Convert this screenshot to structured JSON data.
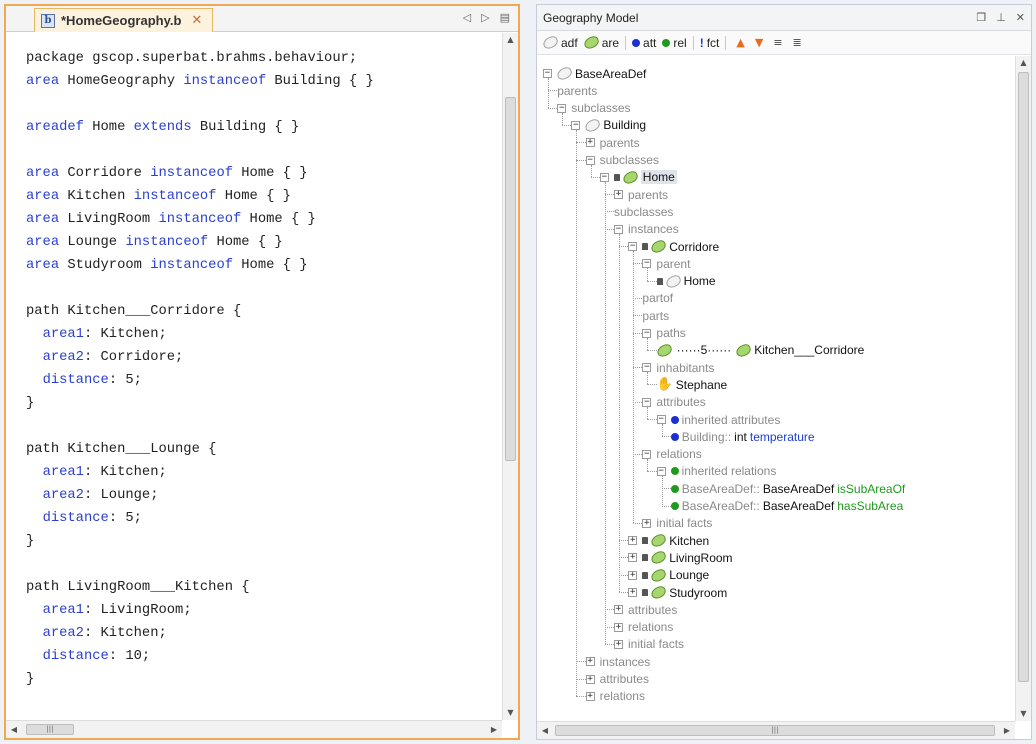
{
  "editor": {
    "tab_label": "*HomeGeography.b",
    "file_icon": "b",
    "code_lines": [
      [
        [
          "t",
          "package gscop.superbat.brahms.behaviour;"
        ]
      ],
      [
        [
          "k",
          "area"
        ],
        [
          "t",
          " HomeGeography "
        ],
        [
          "k",
          "instanceof"
        ],
        [
          "t",
          " Building { }"
        ]
      ],
      [],
      [
        [
          "k",
          "areadef"
        ],
        [
          "t",
          " Home "
        ],
        [
          "k",
          "extends"
        ],
        [
          "t",
          " Building { }"
        ]
      ],
      [],
      [
        [
          "k",
          "area"
        ],
        [
          "t",
          " Corridore "
        ],
        [
          "k",
          "instanceof"
        ],
        [
          "t",
          " Home { }"
        ]
      ],
      [
        [
          "k",
          "area"
        ],
        [
          "t",
          " Kitchen "
        ],
        [
          "k",
          "instanceof"
        ],
        [
          "t",
          " Home { }"
        ]
      ],
      [
        [
          "k",
          "area"
        ],
        [
          "t",
          " LivingRoom "
        ],
        [
          "k",
          "instanceof"
        ],
        [
          "t",
          " Home { }"
        ]
      ],
      [
        [
          "k",
          "area"
        ],
        [
          "t",
          " Lounge "
        ],
        [
          "k",
          "instanceof"
        ],
        [
          "t",
          " Home { }"
        ]
      ],
      [
        [
          "k",
          "area"
        ],
        [
          "t",
          " Studyroom "
        ],
        [
          "k",
          "instanceof"
        ],
        [
          "t",
          " Home { }"
        ]
      ],
      [],
      [
        [
          "t",
          "path Kitchen___Corridore {"
        ]
      ],
      [
        [
          "t",
          "  "
        ],
        [
          "k",
          "area1"
        ],
        [
          "t",
          ": Kitchen;"
        ]
      ],
      [
        [
          "t",
          "  "
        ],
        [
          "k",
          "area2"
        ],
        [
          "t",
          ": Corridore;"
        ]
      ],
      [
        [
          "t",
          "  "
        ],
        [
          "k",
          "distance"
        ],
        [
          "t",
          ": 5;"
        ]
      ],
      [
        [
          "t",
          "}"
        ]
      ],
      [],
      [
        [
          "t",
          "path Kitchen___Lounge {"
        ]
      ],
      [
        [
          "t",
          "  "
        ],
        [
          "k",
          "area1"
        ],
        [
          "t",
          ": Kitchen;"
        ]
      ],
      [
        [
          "t",
          "  "
        ],
        [
          "k",
          "area2"
        ],
        [
          "t",
          ": Lounge;"
        ]
      ],
      [
        [
          "t",
          "  "
        ],
        [
          "k",
          "distance"
        ],
        [
          "t",
          ": 5;"
        ]
      ],
      [
        [
          "t",
          "}"
        ]
      ],
      [],
      [
        [
          "t",
          "path LivingRoom___Kitchen {"
        ]
      ],
      [
        [
          "t",
          "  "
        ],
        [
          "k",
          "area1"
        ],
        [
          "t",
          ": LivingRoom;"
        ]
      ],
      [
        [
          "t",
          "  "
        ],
        [
          "k",
          "area2"
        ],
        [
          "t",
          ": Kitchen;"
        ]
      ],
      [
        [
          "t",
          "  "
        ],
        [
          "k",
          "distance"
        ],
        [
          "t",
          ": 10;"
        ]
      ],
      [
        [
          "t",
          "}"
        ]
      ]
    ]
  },
  "panel": {
    "title": "Geography Model",
    "toolbar": [
      {
        "icon": "grey-blob",
        "label": "adf"
      },
      {
        "icon": "green-blob",
        "label": "are"
      },
      {
        "icon": "blue-dot",
        "label": "att"
      },
      {
        "icon": "green-dot",
        "label": "rel"
      },
      {
        "icon": "exclamation",
        "label": "fct"
      }
    ],
    "tree": [
      {
        "d": 0,
        "exp": "-",
        "icon": "grey-blob",
        "label": "BaseAreaDef",
        "style": "dark"
      },
      {
        "d": 1,
        "label": "parents",
        "style": "grey"
      },
      {
        "d": 1,
        "exp": "-",
        "label": "subclasses",
        "style": "grey"
      },
      {
        "d": 2,
        "exp": "-",
        "icon": "grey-blob",
        "label": "Building",
        "style": "dark"
      },
      {
        "d": 3,
        "exp": "+",
        "label": "parents",
        "style": "grey"
      },
      {
        "d": 3,
        "exp": "-",
        "label": "subclasses",
        "style": "grey"
      },
      {
        "d": 4,
        "exp": "-",
        "lock": true,
        "icon": "green-blob",
        "label": "Home",
        "style": "dark",
        "selected": true
      },
      {
        "d": 5,
        "exp": "+",
        "label": "parents",
        "style": "grey"
      },
      {
        "d": 5,
        "label": "subclasses",
        "style": "grey"
      },
      {
        "d": 5,
        "exp": "-",
        "label": "instances",
        "style": "grey"
      },
      {
        "d": 6,
        "exp": "-",
        "lock": true,
        "icon": "green-blob",
        "label": "Corridore",
        "style": "dark"
      },
      {
        "d": 7,
        "exp": "-",
        "label": "parent",
        "style": "grey"
      },
      {
        "d": 8,
        "lock": true,
        "icon": "grey-blob",
        "label": "Home",
        "style": "dark"
      },
      {
        "d": 7,
        "label": "partof",
        "style": "grey"
      },
      {
        "d": 7,
        "label": "parts",
        "style": "grey"
      },
      {
        "d": 7,
        "exp": "-",
        "label": "paths",
        "style": "grey"
      },
      {
        "d": 8,
        "icon": "green-blob",
        "path": "5",
        "icon2": "green-blob",
        "label": "Kitchen___Corridore",
        "style": "dark"
      },
      {
        "d": 7,
        "exp": "-",
        "label": "inhabitants",
        "style": "grey"
      },
      {
        "d": 8,
        "icon": "hand",
        "label": "Stephane",
        "style": "dark"
      },
      {
        "d": 7,
        "exp": "-",
        "label": "attributes",
        "style": "grey"
      },
      {
        "d": 8,
        "exp": "-",
        "icon": "blue-dot",
        "label": "inherited attributes",
        "style": "grey"
      },
      {
        "d": 9,
        "icon": "blue-dot",
        "pre": "Building::",
        "label": "int",
        "post": "temperature",
        "post_style": "blue",
        "style": "dark"
      },
      {
        "d": 7,
        "exp": "-",
        "label": "relations",
        "style": "grey"
      },
      {
        "d": 8,
        "exp": "-",
        "icon": "green-dot",
        "label": "inherited relations",
        "style": "grey"
      },
      {
        "d": 9,
        "icon": "green-dot",
        "pre": "BaseAreaDef::",
        "label": "BaseAreaDef",
        "post": "isSubAreaOf",
        "post_style": "green",
        "style": "dark"
      },
      {
        "d": 9,
        "icon": "green-dot",
        "pre": "BaseAreaDef::",
        "label": "BaseAreaDef",
        "post": "hasSubArea",
        "post_style": "green",
        "style": "dark"
      },
      {
        "d": 7,
        "exp": "+",
        "label": "initial facts",
        "style": "grey"
      },
      {
        "d": 6,
        "exp": "+",
        "lock": true,
        "icon": "green-blob",
        "label": "Kitchen",
        "style": "dark"
      },
      {
        "d": 6,
        "exp": "+",
        "lock": true,
        "icon": "green-blob",
        "label": "LivingRoom",
        "style": "dark"
      },
      {
        "d": 6,
        "exp": "+",
        "lock": true,
        "icon": "green-blob",
        "label": "Lounge",
        "style": "dark"
      },
      {
        "d": 6,
        "exp": "+",
        "lock": true,
        "icon": "green-blob",
        "label": "Studyroom",
        "style": "dark"
      },
      {
        "d": 5,
        "exp": "+",
        "label": "attributes",
        "style": "grey"
      },
      {
        "d": 5,
        "exp": "+",
        "label": "relations",
        "style": "grey"
      },
      {
        "d": 5,
        "exp": "+",
        "label": "initial facts",
        "style": "grey"
      },
      {
        "d": 3,
        "exp": "+",
        "label": "instances",
        "style": "grey"
      },
      {
        "d": 3,
        "exp": "+",
        "label": "attributes",
        "style": "grey"
      },
      {
        "d": 3,
        "exp": "+",
        "label": "relations",
        "style": "grey"
      }
    ]
  }
}
